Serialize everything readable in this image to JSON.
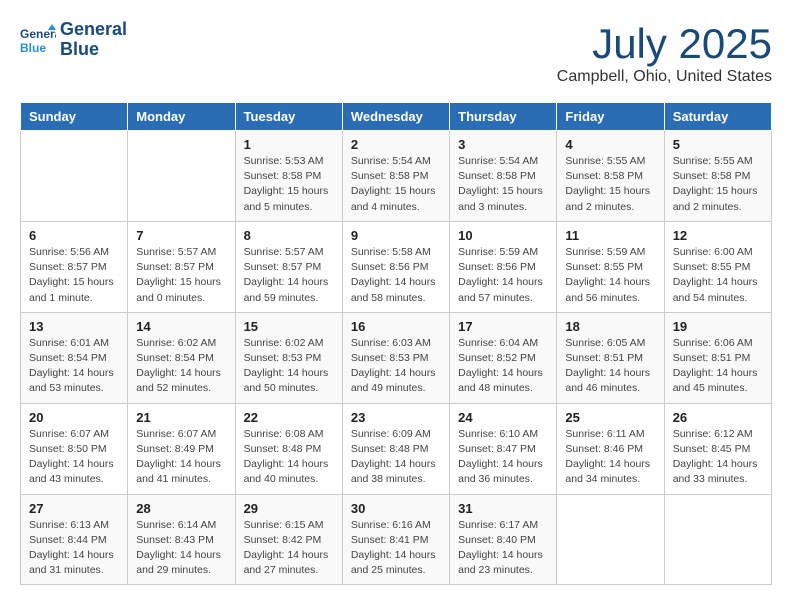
{
  "header": {
    "logo_line1": "General",
    "logo_line2": "Blue",
    "title": "July 2025",
    "subtitle": "Campbell, Ohio, United States"
  },
  "weekdays": [
    "Sunday",
    "Monday",
    "Tuesday",
    "Wednesday",
    "Thursday",
    "Friday",
    "Saturday"
  ],
  "weeks": [
    [
      {
        "day": "",
        "detail": ""
      },
      {
        "day": "",
        "detail": ""
      },
      {
        "day": "1",
        "detail": "Sunrise: 5:53 AM\nSunset: 8:58 PM\nDaylight: 15 hours\nand 5 minutes."
      },
      {
        "day": "2",
        "detail": "Sunrise: 5:54 AM\nSunset: 8:58 PM\nDaylight: 15 hours\nand 4 minutes."
      },
      {
        "day": "3",
        "detail": "Sunrise: 5:54 AM\nSunset: 8:58 PM\nDaylight: 15 hours\nand 3 minutes."
      },
      {
        "day": "4",
        "detail": "Sunrise: 5:55 AM\nSunset: 8:58 PM\nDaylight: 15 hours\nand 2 minutes."
      },
      {
        "day": "5",
        "detail": "Sunrise: 5:55 AM\nSunset: 8:58 PM\nDaylight: 15 hours\nand 2 minutes."
      }
    ],
    [
      {
        "day": "6",
        "detail": "Sunrise: 5:56 AM\nSunset: 8:57 PM\nDaylight: 15 hours\nand 1 minute."
      },
      {
        "day": "7",
        "detail": "Sunrise: 5:57 AM\nSunset: 8:57 PM\nDaylight: 15 hours\nand 0 minutes."
      },
      {
        "day": "8",
        "detail": "Sunrise: 5:57 AM\nSunset: 8:57 PM\nDaylight: 14 hours\nand 59 minutes."
      },
      {
        "day": "9",
        "detail": "Sunrise: 5:58 AM\nSunset: 8:56 PM\nDaylight: 14 hours\nand 58 minutes."
      },
      {
        "day": "10",
        "detail": "Sunrise: 5:59 AM\nSunset: 8:56 PM\nDaylight: 14 hours\nand 57 minutes."
      },
      {
        "day": "11",
        "detail": "Sunrise: 5:59 AM\nSunset: 8:55 PM\nDaylight: 14 hours\nand 56 minutes."
      },
      {
        "day": "12",
        "detail": "Sunrise: 6:00 AM\nSunset: 8:55 PM\nDaylight: 14 hours\nand 54 minutes."
      }
    ],
    [
      {
        "day": "13",
        "detail": "Sunrise: 6:01 AM\nSunset: 8:54 PM\nDaylight: 14 hours\nand 53 minutes."
      },
      {
        "day": "14",
        "detail": "Sunrise: 6:02 AM\nSunset: 8:54 PM\nDaylight: 14 hours\nand 52 minutes."
      },
      {
        "day": "15",
        "detail": "Sunrise: 6:02 AM\nSunset: 8:53 PM\nDaylight: 14 hours\nand 50 minutes."
      },
      {
        "day": "16",
        "detail": "Sunrise: 6:03 AM\nSunset: 8:53 PM\nDaylight: 14 hours\nand 49 minutes."
      },
      {
        "day": "17",
        "detail": "Sunrise: 6:04 AM\nSunset: 8:52 PM\nDaylight: 14 hours\nand 48 minutes."
      },
      {
        "day": "18",
        "detail": "Sunrise: 6:05 AM\nSunset: 8:51 PM\nDaylight: 14 hours\nand 46 minutes."
      },
      {
        "day": "19",
        "detail": "Sunrise: 6:06 AM\nSunset: 8:51 PM\nDaylight: 14 hours\nand 45 minutes."
      }
    ],
    [
      {
        "day": "20",
        "detail": "Sunrise: 6:07 AM\nSunset: 8:50 PM\nDaylight: 14 hours\nand 43 minutes."
      },
      {
        "day": "21",
        "detail": "Sunrise: 6:07 AM\nSunset: 8:49 PM\nDaylight: 14 hours\nand 41 minutes."
      },
      {
        "day": "22",
        "detail": "Sunrise: 6:08 AM\nSunset: 8:48 PM\nDaylight: 14 hours\nand 40 minutes."
      },
      {
        "day": "23",
        "detail": "Sunrise: 6:09 AM\nSunset: 8:48 PM\nDaylight: 14 hours\nand 38 minutes."
      },
      {
        "day": "24",
        "detail": "Sunrise: 6:10 AM\nSunset: 8:47 PM\nDaylight: 14 hours\nand 36 minutes."
      },
      {
        "day": "25",
        "detail": "Sunrise: 6:11 AM\nSunset: 8:46 PM\nDaylight: 14 hours\nand 34 minutes."
      },
      {
        "day": "26",
        "detail": "Sunrise: 6:12 AM\nSunset: 8:45 PM\nDaylight: 14 hours\nand 33 minutes."
      }
    ],
    [
      {
        "day": "27",
        "detail": "Sunrise: 6:13 AM\nSunset: 8:44 PM\nDaylight: 14 hours\nand 31 minutes."
      },
      {
        "day": "28",
        "detail": "Sunrise: 6:14 AM\nSunset: 8:43 PM\nDaylight: 14 hours\nand 29 minutes."
      },
      {
        "day": "29",
        "detail": "Sunrise: 6:15 AM\nSunset: 8:42 PM\nDaylight: 14 hours\nand 27 minutes."
      },
      {
        "day": "30",
        "detail": "Sunrise: 6:16 AM\nSunset: 8:41 PM\nDaylight: 14 hours\nand 25 minutes."
      },
      {
        "day": "31",
        "detail": "Sunrise: 6:17 AM\nSunset: 8:40 PM\nDaylight: 14 hours\nand 23 minutes."
      },
      {
        "day": "",
        "detail": ""
      },
      {
        "day": "",
        "detail": ""
      }
    ]
  ]
}
